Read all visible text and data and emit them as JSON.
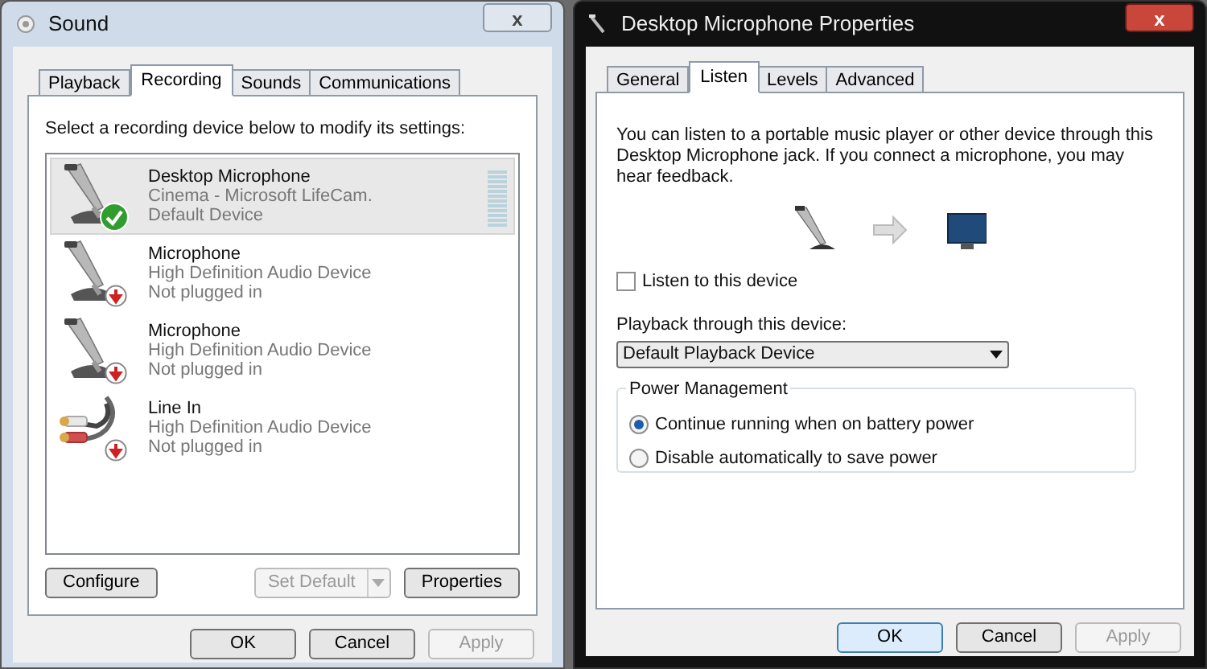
{
  "sound_window": {
    "title": "Sound",
    "close": "x",
    "tabs": [
      {
        "label": "Playback",
        "selected": false
      },
      {
        "label": "Recording",
        "selected": true
      },
      {
        "label": "Sounds",
        "selected": false
      },
      {
        "label": "Communications",
        "selected": false
      }
    ],
    "instruction": "Select a recording device below to modify its settings:",
    "devices": [
      {
        "kind": "microphone",
        "default": true,
        "plugged_in": true,
        "name": "Desktop Microphone",
        "description": "Cinema - Microsoft LifeCam.",
        "status": "Default Device",
        "selected": true,
        "level": 0
      },
      {
        "kind": "microphone",
        "default": false,
        "plugged_in": false,
        "name": "Microphone",
        "description": "High Definition Audio Device",
        "status": "Not plugged in",
        "selected": false
      },
      {
        "kind": "microphone",
        "default": false,
        "plugged_in": false,
        "name": "Microphone",
        "description": "High Definition Audio Device",
        "status": "Not plugged in",
        "selected": false
      },
      {
        "kind": "line-in",
        "default": false,
        "plugged_in": false,
        "name": "Line In",
        "description": "High Definition Audio Device",
        "status": "Not plugged in",
        "selected": false
      }
    ],
    "panel_buttons": [
      {
        "kind": "button",
        "label": "Configure",
        "disabled": false
      },
      {
        "kind": "split",
        "label": "Set Default",
        "disabled": true
      },
      {
        "kind": "button",
        "label": "Properties",
        "disabled": false
      }
    ],
    "dialog_buttons": [
      {
        "label": "OK",
        "disabled": false,
        "default": false
      },
      {
        "label": "Cancel",
        "disabled": false,
        "default": false
      },
      {
        "label": "Apply",
        "disabled": true,
        "default": false
      }
    ]
  },
  "properties_window": {
    "title": "Desktop Microphone Properties",
    "close": "x",
    "tabs": [
      {
        "label": "General",
        "selected": false
      },
      {
        "label": "Listen",
        "selected": true
      },
      {
        "label": "Levels",
        "selected": false
      },
      {
        "label": "Advanced",
        "selected": false
      }
    ],
    "description": "You can listen to a portable music player or other device through this Desktop Microphone jack.  If you connect a microphone, you may hear feedback.",
    "listen_checkbox": {
      "label": "Listen to this device",
      "checked": false
    },
    "playback_label": "Playback through this device:",
    "playback_dropdown": {
      "value": "Default Playback Device"
    },
    "power_management": {
      "title": "Power Management",
      "options": [
        {
          "label": "Continue running when on battery power",
          "selected": true
        },
        {
          "label": "Disable automatically to save power",
          "selected": false
        }
      ]
    },
    "dialog_buttons": [
      {
        "label": "OK",
        "disabled": false,
        "default": true
      },
      {
        "label": "Cancel",
        "disabled": false,
        "default": false
      },
      {
        "label": "Apply",
        "disabled": true,
        "default": false
      }
    ]
  }
}
